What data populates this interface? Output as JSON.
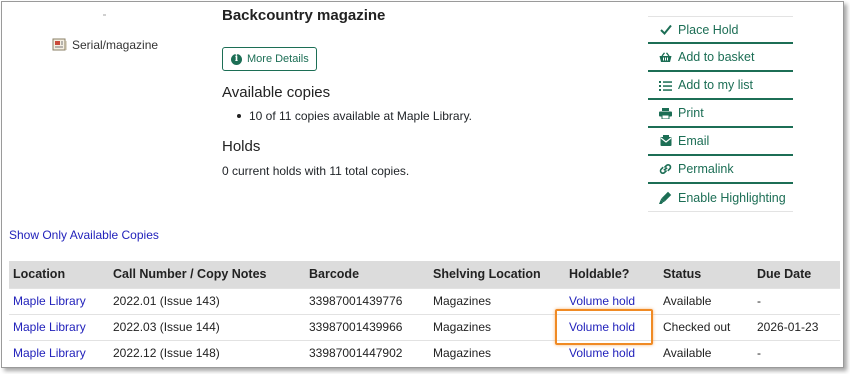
{
  "record": {
    "title": "Backcountry magazine",
    "format": "Serial/magazine",
    "more_details_label": "More Details"
  },
  "availability": {
    "heading": "Available copies",
    "summary": "10 of 11 copies available at Maple Library."
  },
  "holds": {
    "heading": "Holds",
    "summary": "0 current holds with 11 total copies."
  },
  "actions": [
    {
      "label": "Place Hold",
      "icon": "check-icon"
    },
    {
      "label": "Add to basket",
      "icon": "basket-icon"
    },
    {
      "label": "Add to my list",
      "icon": "list-icon"
    },
    {
      "label": "Print",
      "icon": "print-icon"
    },
    {
      "label": "Email",
      "icon": "email-icon"
    },
    {
      "label": "Permalink",
      "icon": "link-icon"
    },
    {
      "label": "Enable Highlighting",
      "icon": "highlighter-icon"
    }
  ],
  "show_only_available": "Show Only Available Copies",
  "table": {
    "headers": [
      "Location",
      "Call Number / Copy Notes",
      "Barcode",
      "Shelving Location",
      "Holdable?",
      "Status",
      "Due Date"
    ],
    "rows": [
      {
        "location": "Maple Library",
        "call_number": "2022.01 (Issue 143)",
        "barcode": "33987001439776",
        "shelving": "Magazines",
        "holdable": "Volume hold",
        "status": "Available",
        "due": "-"
      },
      {
        "location": "Maple Library",
        "call_number": "2022.03 (Issue 144)",
        "barcode": "33987001439966",
        "shelving": "Magazines",
        "holdable": "Volume hold",
        "status": "Checked out",
        "due": "2026-01-23"
      },
      {
        "location": "Maple Library",
        "call_number": "2022.12 (Issue 148)",
        "barcode": "33987001447902",
        "shelving": "Magazines",
        "holdable": "Volume hold",
        "status": "Available",
        "due": "-"
      }
    ]
  },
  "colors": {
    "accent": "#1c6e55",
    "link": "#2222bb",
    "highlight": "#f08a24",
    "table_header": "#dcdcdc"
  }
}
